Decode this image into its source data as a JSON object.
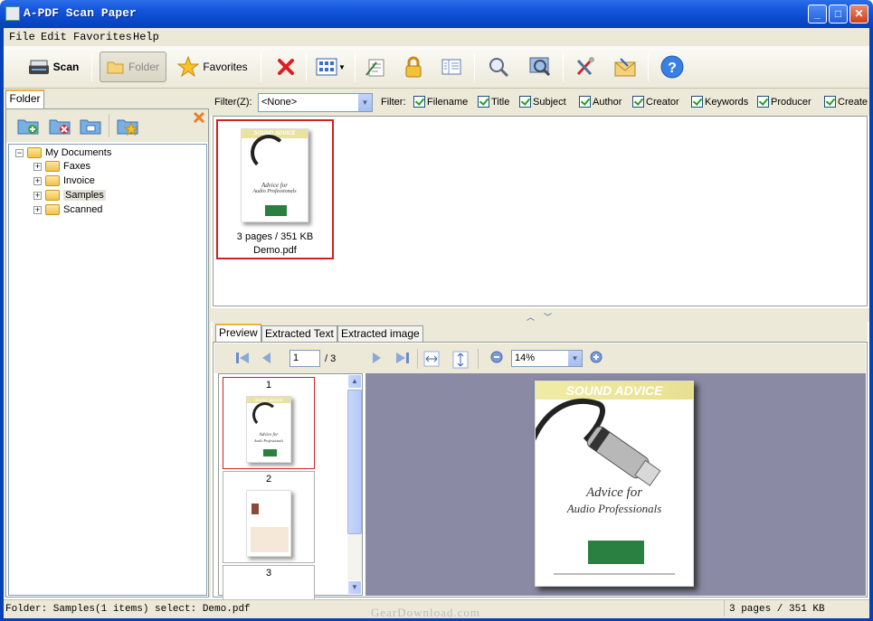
{
  "window": {
    "title": "A-PDF Scan Paper",
    "minimize": "_",
    "maximize": "□",
    "close": "✕"
  },
  "menu": [
    "File",
    "Edit",
    "Favorites",
    "Help"
  ],
  "toolbar": {
    "scan_label": "Scan",
    "folder_label": "Folder",
    "favorites_label": "Favorites"
  },
  "left_panel": {
    "tab_label": "Folder",
    "tree": {
      "root": "My Documents",
      "children": [
        "Faxes",
        "Invoice",
        "Samples",
        "Scanned"
      ],
      "selected": "Samples"
    }
  },
  "filter": {
    "label": "Filter(Z):",
    "selected": "<None>",
    "fields_label": "Filter:",
    "fields": [
      "Filename",
      "Title",
      "Subject",
      "Author",
      "Creator",
      "Keywords",
      "Producer",
      "Create"
    ]
  },
  "file": {
    "info": "3 pages / 351 KB",
    "name": "Demo.pdf",
    "doc_banner": "SOUND ADVICE",
    "doc_title_line1": "Advice for",
    "doc_title_line2": "Audio Professionals"
  },
  "tabs": [
    "Preview",
    "Extracted Text",
    "Extracted image"
  ],
  "navigation": {
    "current_page": "1",
    "total_pages": "/ 3",
    "zoom": "14%"
  },
  "thumbnails": [
    "1",
    "2",
    "3"
  ],
  "status": {
    "left": "Folder: Samples(1 items) select: Demo.pdf",
    "right": "3 pages / 351 KB"
  },
  "watermark": "GearDownload.com",
  "colors": {
    "titlebar": "#0a49c9",
    "chrome": "#ece9d8",
    "selection_border": "#d02020",
    "viewer_bg": "#8a8aa5"
  }
}
